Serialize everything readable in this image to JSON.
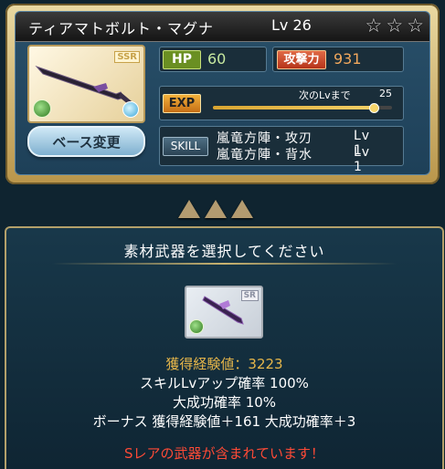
{
  "weapon": {
    "name": "ティアマトボルト・マグナ",
    "level": "Lv 26",
    "rarity_badge": "SSR",
    "hp_label": "HP",
    "hp": "60",
    "atk_label": "攻撃力",
    "atk": "931",
    "exp_label": "EXP",
    "next_label": "次のLvまで",
    "next_value": "25",
    "exp_progress": 0.9,
    "skill_label": "SKILL",
    "skills": [
      {
        "name": "嵐竜方陣・攻刃",
        "level": "Lv 1"
      },
      {
        "name": "嵐竜方陣・背水",
        "level": "Lv 1"
      }
    ],
    "base_change_button": "ベース変更"
  },
  "material": {
    "prompt": "素材武器を選択してください",
    "rarity_badge": "SR",
    "gained_exp_label": "獲得経験値：",
    "gained_exp_value": "3223",
    "skill_up_rate": "スキルLvアップ確率 100%",
    "great_success_rate": "大成功確率 10%",
    "bonus": "ボーナス 獲得経験値＋161 大成功確率＋3",
    "warning": "Sレアの武器が含まれています！"
  },
  "colors": {
    "accent_gold": "#c7a24a",
    "warning_red": "#ff4a36",
    "exp_orange": "#e6b64a"
  }
}
